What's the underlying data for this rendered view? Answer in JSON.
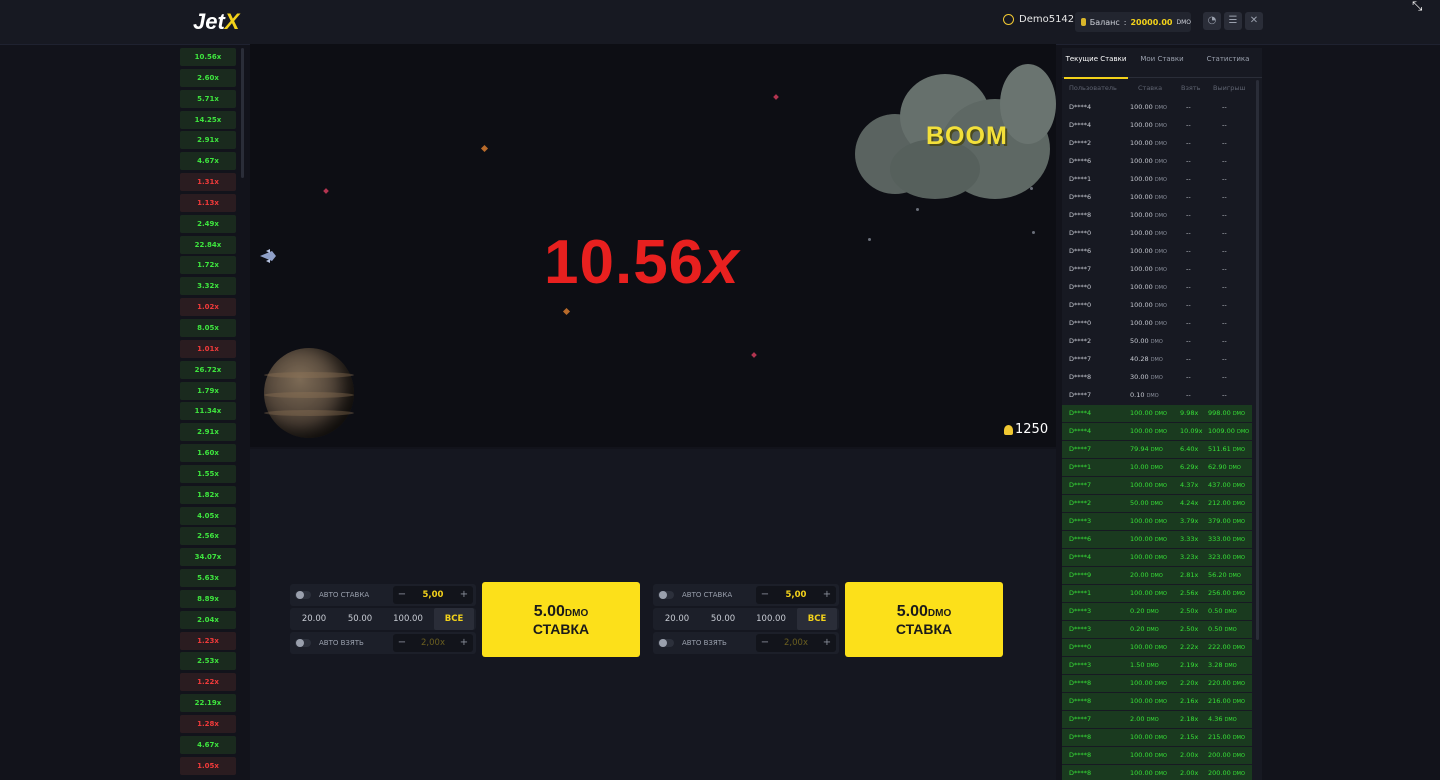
{
  "header": {
    "logo_main": "Jet",
    "logo_x": "X",
    "username": "Demo5142",
    "balance_label": "Баланс",
    "balance_value": "20000.00",
    "currency": "DMO",
    "chat_icon": "chat-icon",
    "menu_icon": "menu-icon",
    "close_icon": "close-icon",
    "corner_icon": "shrink-icon"
  },
  "history": [
    {
      "v": "10.56x",
      "c": "g"
    },
    {
      "v": "2.60x",
      "c": "g"
    },
    {
      "v": "5.71x",
      "c": "g"
    },
    {
      "v": "14.25x",
      "c": "g"
    },
    {
      "v": "2.91x",
      "c": "g"
    },
    {
      "v": "4.67x",
      "c": "g"
    },
    {
      "v": "1.31x",
      "c": "r"
    },
    {
      "v": "1.13x",
      "c": "r"
    },
    {
      "v": "2.49x",
      "c": "g"
    },
    {
      "v": "22.84x",
      "c": "g"
    },
    {
      "v": "1.72x",
      "c": "g"
    },
    {
      "v": "3.32x",
      "c": "g"
    },
    {
      "v": "1.02x",
      "c": "r"
    },
    {
      "v": "8.05x",
      "c": "g"
    },
    {
      "v": "1.01x",
      "c": "r"
    },
    {
      "v": "26.72x",
      "c": "g"
    },
    {
      "v": "1.79x",
      "c": "g"
    },
    {
      "v": "11.34x",
      "c": "g"
    },
    {
      "v": "2.91x",
      "c": "g"
    },
    {
      "v": "1.60x",
      "c": "g"
    },
    {
      "v": "1.55x",
      "c": "g"
    },
    {
      "v": "1.82x",
      "c": "g"
    },
    {
      "v": "4.05x",
      "c": "g"
    },
    {
      "v": "2.56x",
      "c": "g"
    },
    {
      "v": "34.07x",
      "c": "g"
    },
    {
      "v": "5.63x",
      "c": "g"
    },
    {
      "v": "8.89x",
      "c": "g"
    },
    {
      "v": "2.04x",
      "c": "g"
    },
    {
      "v": "1.23x",
      "c": "r"
    },
    {
      "v": "2.53x",
      "c": "g"
    },
    {
      "v": "1.22x",
      "c": "r"
    },
    {
      "v": "22.19x",
      "c": "g"
    },
    {
      "v": "1.28x",
      "c": "r"
    },
    {
      "v": "4.67x",
      "c": "g"
    },
    {
      "v": "1.05x",
      "c": "r"
    }
  ],
  "game": {
    "multiplier": "10.56",
    "multiplier_suffix": "x",
    "boom_text": "BOOM",
    "players_count": "1250",
    "players_icon": "user-icon"
  },
  "bet_panels": [
    {
      "auto_bet_label": "АВТО СТАВКА",
      "amount": "5,00",
      "quick": [
        "20.00",
        "50.00",
        "100.00",
        "ВСЕ"
      ],
      "auto_cashout_label": "АВТО ВЗЯТЬ",
      "cashout_value": "2,00x",
      "button_amount": "5.00",
      "button_currency": "DMO",
      "button_label": "СТАВКА"
    },
    {
      "auto_bet_label": "АВТО СТАВКА",
      "amount": "5,00",
      "quick": [
        "20.00",
        "50.00",
        "100.00",
        "ВСЕ"
      ],
      "auto_cashout_label": "АВТО ВЗЯТЬ",
      "cashout_value": "2,00x",
      "button_amount": "5.00",
      "button_currency": "DMO",
      "button_label": "СТАВКА"
    }
  ],
  "side": {
    "tabs": [
      "Текущие Ставки",
      "Мои Ставки",
      "Статистика"
    ],
    "columns": [
      "Пользователь",
      "Ставка",
      "Взять",
      "Выигрыш"
    ],
    "rows": [
      {
        "u": "D****4",
        "s": "100.00",
        "c": "--",
        "w": "--",
        "win": false
      },
      {
        "u": "D****4",
        "s": "100.00",
        "c": "--",
        "w": "--",
        "win": false
      },
      {
        "u": "D****2",
        "s": "100.00",
        "c": "--",
        "w": "--",
        "win": false
      },
      {
        "u": "D****6",
        "s": "100.00",
        "c": "--",
        "w": "--",
        "win": false
      },
      {
        "u": "D****1",
        "s": "100.00",
        "c": "--",
        "w": "--",
        "win": false
      },
      {
        "u": "D****6",
        "s": "100.00",
        "c": "--",
        "w": "--",
        "win": false
      },
      {
        "u": "D****8",
        "s": "100.00",
        "c": "--",
        "w": "--",
        "win": false
      },
      {
        "u": "D****0",
        "s": "100.00",
        "c": "--",
        "w": "--",
        "win": false
      },
      {
        "u": "D****6",
        "s": "100.00",
        "c": "--",
        "w": "--",
        "win": false
      },
      {
        "u": "D****7",
        "s": "100.00",
        "c": "--",
        "w": "--",
        "win": false
      },
      {
        "u": "D****0",
        "s": "100.00",
        "c": "--",
        "w": "--",
        "win": false
      },
      {
        "u": "D****0",
        "s": "100.00",
        "c": "--",
        "w": "--",
        "win": false
      },
      {
        "u": "D****0",
        "s": "100.00",
        "c": "--",
        "w": "--",
        "win": false
      },
      {
        "u": "D****2",
        "s": "50.00",
        "c": "--",
        "w": "--",
        "win": false
      },
      {
        "u": "D****7",
        "s": "40.28",
        "c": "--",
        "w": "--",
        "win": false
      },
      {
        "u": "D****8",
        "s": "30.00",
        "c": "--",
        "w": "--",
        "win": false
      },
      {
        "u": "D****7",
        "s": "0.10",
        "c": "--",
        "w": "--",
        "win": false
      },
      {
        "u": "D****4",
        "s": "100.00",
        "c": "9.98x",
        "w": "998.00",
        "win": true
      },
      {
        "u": "D****4",
        "s": "100.00",
        "c": "10.09x",
        "w": "1009.00",
        "win": true
      },
      {
        "u": "D****7",
        "s": "79.94",
        "c": "6.40x",
        "w": "511.61",
        "win": true
      },
      {
        "u": "D****1",
        "s": "10.00",
        "c": "6.29x",
        "w": "62.90",
        "win": true
      },
      {
        "u": "D****7",
        "s": "100.00",
        "c": "4.37x",
        "w": "437.00",
        "win": true
      },
      {
        "u": "D****2",
        "s": "50.00",
        "c": "4.24x",
        "w": "212.00",
        "win": true
      },
      {
        "u": "D****3",
        "s": "100.00",
        "c": "3.79x",
        "w": "379.00",
        "win": true
      },
      {
        "u": "D****6",
        "s": "100.00",
        "c": "3.33x",
        "w": "333.00",
        "win": true
      },
      {
        "u": "D****4",
        "s": "100.00",
        "c": "3.23x",
        "w": "323.00",
        "win": true
      },
      {
        "u": "D****9",
        "s": "20.00",
        "c": "2.81x",
        "w": "56.20",
        "win": true
      },
      {
        "u": "D****1",
        "s": "100.00",
        "c": "2.56x",
        "w": "256.00",
        "win": true
      },
      {
        "u": "D****3",
        "s": "0.20",
        "c": "2.50x",
        "w": "0.50",
        "win": true
      },
      {
        "u": "D****3",
        "s": "0.20",
        "c": "2.50x",
        "w": "0.50",
        "win": true
      },
      {
        "u": "D****0",
        "s": "100.00",
        "c": "2.22x",
        "w": "222.00",
        "win": true
      },
      {
        "u": "D****3",
        "s": "1.50",
        "c": "2.19x",
        "w": "3.28",
        "win": true
      },
      {
        "u": "D****8",
        "s": "100.00",
        "c": "2.20x",
        "w": "220.00",
        "win": true
      },
      {
        "u": "D****8",
        "s": "100.00",
        "c": "2.16x",
        "w": "216.00",
        "win": true
      },
      {
        "u": "D****7",
        "s": "2.00",
        "c": "2.18x",
        "w": "4.36",
        "win": true
      },
      {
        "u": "D****8",
        "s": "100.00",
        "c": "2.15x",
        "w": "215.00",
        "win": true
      },
      {
        "u": "D****8",
        "s": "100.00",
        "c": "2.00x",
        "w": "200.00",
        "win": true
      },
      {
        "u": "D****8",
        "s": "100.00",
        "c": "2.00x",
        "w": "200.00",
        "win": true
      }
    ]
  }
}
